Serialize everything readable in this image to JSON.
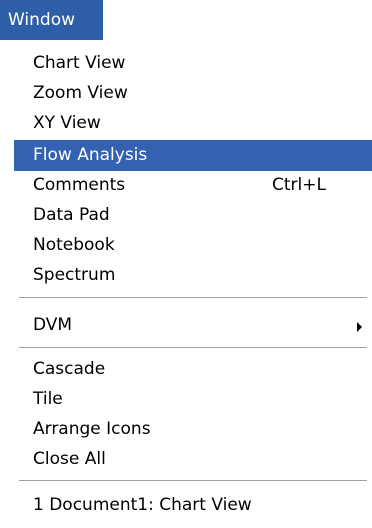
{
  "menubar": {
    "title": "Window"
  },
  "menu": {
    "group1": [
      {
        "label": "Chart View",
        "shortcut": ""
      },
      {
        "label": "Zoom View",
        "shortcut": ""
      },
      {
        "label": "XY View",
        "shortcut": ""
      },
      {
        "label": "Flow Analysis",
        "shortcut": ""
      },
      {
        "label": "Comments",
        "shortcut": "Ctrl+L"
      },
      {
        "label": "Data Pad",
        "shortcut": ""
      },
      {
        "label": "Notebook",
        "shortcut": ""
      },
      {
        "label": "Spectrum",
        "shortcut": ""
      }
    ],
    "group2": [
      {
        "label": "DVM",
        "submenu_icon": "submenu-arrow-icon"
      }
    ],
    "group3": [
      {
        "label": "Cascade"
      },
      {
        "label": "Tile"
      },
      {
        "label": "Arrange Icons"
      },
      {
        "label": "Close All"
      }
    ],
    "group4": [
      {
        "label": "1 Document1: Chart View"
      }
    ],
    "highlighted_item": "Flow Analysis"
  },
  "colors": {
    "highlight": "#3462b0",
    "menubar_title_bg": "#2f5ea8",
    "separator": "#a0a0a0"
  }
}
